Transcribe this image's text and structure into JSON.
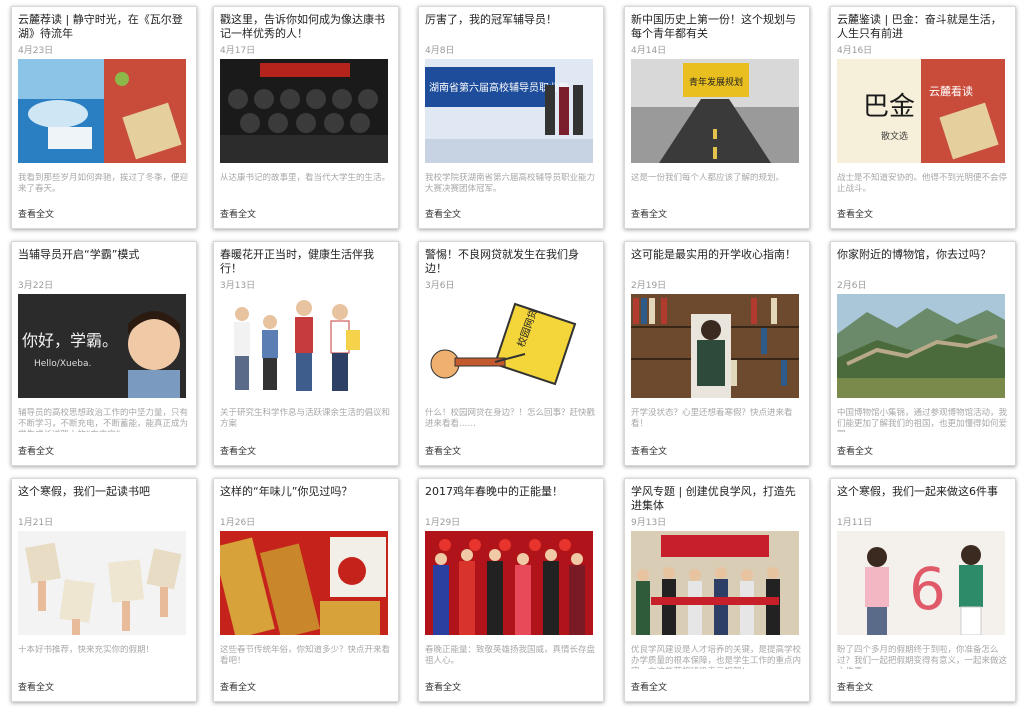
{
  "cards": [
    {
      "title": "云麓荐读 | 静守时光，在《瓦尔登湖》待流年",
      "date": "4月23日",
      "summary": "我看到那些岁月如何奔驰，挨过了冬季，便迎来了春天。",
      "more": "查看全文",
      "image": "walden-book-cover"
    },
    {
      "title": "戳这里，告诉你如何成为像达康书记一样优秀的人！",
      "date": "4月17日",
      "summary": "从达康书记的故事里，看当代大学生的生活。",
      "more": "查看全文",
      "image": "tv-drama-poster"
    },
    {
      "title": "厉害了，我的冠军辅导员！",
      "date": "4月8日",
      "summary": "我校学院获湖南省第六届高校辅导员职业能力大赛决赛团体冠军。",
      "more": "查看全文",
      "image": "award-ceremony",
      "banner": "湖南省第六届高校辅导员职业能"
    },
    {
      "title": "新中国历史上第一份！这个规划与每个青年都有关",
      "date": "4月14日",
      "summary": "这是一份我们每个人都应该了解的规划。",
      "more": "查看全文",
      "image": "youth-plan-road",
      "banner": "青年发展规划"
    },
    {
      "title": "云麓鉴读 | 巴金：奋斗就是生活，人生只有前进",
      "date": "4月16日",
      "summary": "战士是不知道安协的。他得不到光明便不会停止战斗。",
      "more": "查看全文",
      "image": "bajin-book-cover",
      "book_title": "巴金",
      "book_sub": "散文选",
      "logo": "云麓看读"
    },
    {
      "title": "当辅导员开启“学霸”模式",
      "date": "3月22日",
      "summary": "辅导员的高校思想政治工作的中坚力量，只有不断学习，不断充电，不断蓄能，能真正成为学生成长道路上的“充电宝”。",
      "more": "查看全文",
      "image": "xueba-boy",
      "chalk_text": "你好，学霸。",
      "chalk_sub": "Hello/Xueba."
    },
    {
      "title": "春暖花开正当时，健康生活伴我行！",
      "date": "3月13日",
      "summary": "关于研究生科学作息与活跃课余生活的倡议和方案",
      "more": "查看全文",
      "image": "students-group"
    },
    {
      "title": "警惕！不良网贷就发生在我们身边！",
      "date": "3月6日",
      "summary": "什么！校园网贷在身边？！怎么回事？赶快戳进来看看……",
      "more": "查看全文",
      "image": "campus-loan-cartoon",
      "sign_text": "校园网贷"
    },
    {
      "title": "这可能是最实用的开学收心指南！",
      "date": "2月19日",
      "summary": "开学没状态？心里还想着寒假？快点进来看看！",
      "more": "查看全文",
      "image": "library-reading"
    },
    {
      "title": "你家附近的博物馆，你去过吗？",
      "date": "2月6日",
      "summary": "中国博物馆小集锦，通过参观博物馆活动，我们能更加了解我们的祖国，也更加懂得如何爱国。",
      "more": "查看全文",
      "image": "great-wall"
    },
    {
      "title": "这个寒假，我们一起读书吧",
      "date": "1月21日",
      "summary": "十本好书推荐，快来充实你的假期！",
      "more": "查看全文",
      "image": "hands-books"
    },
    {
      "title": "这样的“年味儿”你见过吗？",
      "date": "1月26日",
      "summary": "这些春节传统年俗，你知道多少？快点开来看看吧！",
      "more": "查看全文",
      "image": "spring-couplets"
    },
    {
      "title": "2017鸡年春晚中的正能量！",
      "date": "1月29日",
      "summary": "春晚正能量：致敬英雄扬我国威，真情长存盘祖人心。",
      "more": "查看全文",
      "image": "gala-stage"
    },
    {
      "title": "学风专题 | 创建优良学风，打造先进集体",
      "date": "9月13日",
      "summary": "优良学风建设是人才培养的关键，是提高学校办学质量的根本保障，也是学生工作的重点内容。向这些获奖班级表示祝贺！",
      "more": "查看全文",
      "image": "award-group"
    },
    {
      "title": "这个寒假，我们一起来做这6件事",
      "date": "1月11日",
      "summary": "盼了四个多月的假期终于到啦，你准备怎么过？我们一起把假期变得有意义，一起来做这六件事",
      "more": "查看全文",
      "image": "six-things",
      "big_number": "6"
    }
  ]
}
